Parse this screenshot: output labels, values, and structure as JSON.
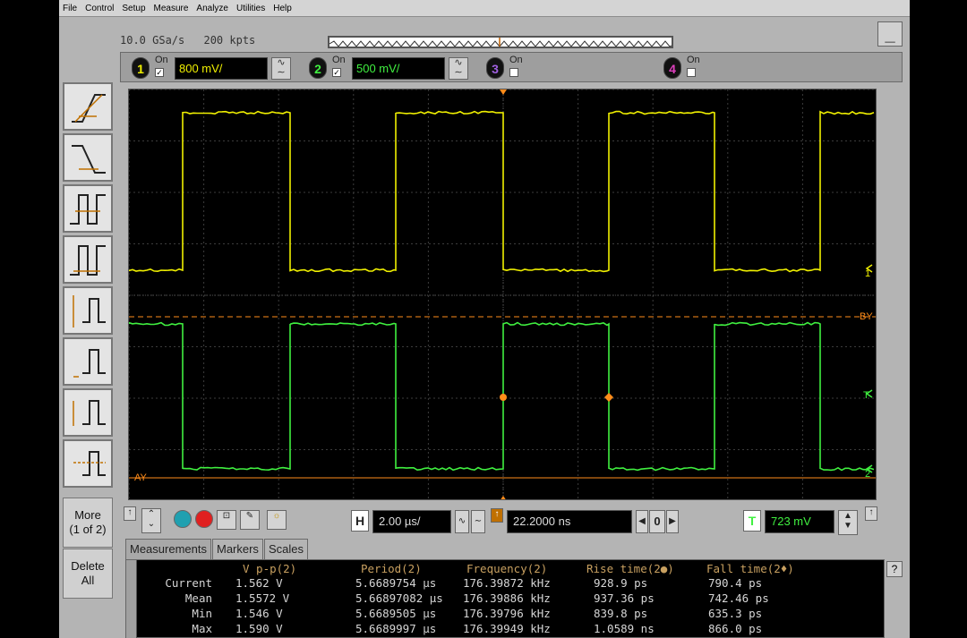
{
  "menu": [
    "File",
    "Control",
    "Setup",
    "Measure",
    "Analyze",
    "Utilities",
    "Help"
  ],
  "acquisition": {
    "sample_rate": "10.0 GSa/s",
    "memory_depth": "200 kpts"
  },
  "minimize_label": "_",
  "channels": [
    {
      "num": "1",
      "on_label": "On",
      "checked": "✓",
      "scale": "800 mV/",
      "color": "#f0f000"
    },
    {
      "num": "2",
      "on_label": "On",
      "checked": "✓",
      "scale": "500 mV/",
      "color": "#40f040"
    },
    {
      "num": "3",
      "on_label": "On",
      "checked": "",
      "color": "#8040c0"
    },
    {
      "num": "4",
      "on_label": "On",
      "checked": "",
      "color": "#e040c0"
    }
  ],
  "sidebar": {
    "more_label": "More\n(1 of 2)",
    "delete_label": "Delete\nAll"
  },
  "markers": {
    "by_label": "BY",
    "ay_label": "AY",
    "t_label": "T",
    "ch1_label": "1",
    "ch2_label": "2"
  },
  "controls": {
    "h_label": "H",
    "timebase": "2.00 µs/",
    "delay": "22.2000 ns",
    "delay_ref": "0",
    "t_label": "T",
    "trigger_level": "723 mV"
  },
  "tabs": [
    "Measurements",
    "Markers",
    "Scales"
  ],
  "help_label": "?",
  "measurements": {
    "headers": [
      "V p-p(2)",
      "Period(2)",
      "Frequency(2)",
      "Rise time(2●)",
      "Fall time(2♦)"
    ],
    "rows": [
      {
        "label": "Current",
        "values": [
          "1.562 V",
          "5.6689754 µs",
          "176.39872 kHz",
          "928.9 ps",
          "790.4 ps"
        ]
      },
      {
        "label": "Mean",
        "values": [
          "1.5572 V",
          "5.66897082 µs",
          "176.39886 kHz",
          "937.36 ps",
          "742.46 ps"
        ]
      },
      {
        "label": "Min",
        "values": [
          "1.546 V",
          "5.6689505 µs",
          "176.39796 kHz",
          "839.8 ps",
          "635.3 ps"
        ]
      },
      {
        "label": "Max",
        "values": [
          "1.590 V",
          "5.6689997 µs",
          "176.39949 kHz",
          "1.0589 ns",
          "866.0 ps"
        ]
      }
    ]
  },
  "colors": {
    "ch1": "#f0f000",
    "ch2": "#40f040",
    "marker": "#ff8c1a",
    "grid": "#3c3c3c"
  }
}
